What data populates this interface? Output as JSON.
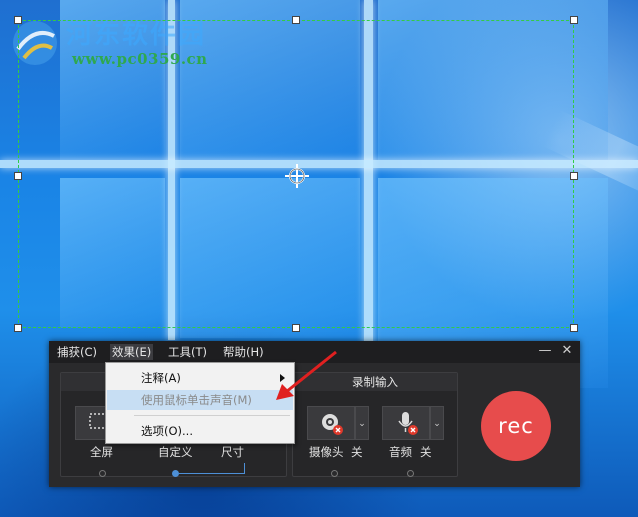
{
  "watermark": {
    "title": "河东软件园",
    "url": "www.pc0359.cn"
  },
  "recorder": {
    "menu": [
      {
        "label": "捕获(C)"
      },
      {
        "label": "效果(E)"
      },
      {
        "label": "工具(T)"
      },
      {
        "label": "帮助(H)"
      }
    ],
    "window_controls": {
      "minimize": "—",
      "close": "✕"
    },
    "capture_group": {
      "fullscreen_label": "全屏",
      "custom_label": "自定义",
      "size_label": "尺寸"
    },
    "record_input_group": {
      "title": "录制输入",
      "camera_label": "摄像头",
      "camera_state": "关",
      "audio_label": "音频",
      "audio_state": "关"
    },
    "rec_label": "rec"
  },
  "effects_menu": {
    "items": [
      {
        "label": "注释(A)",
        "has_submenu": true,
        "highlighted": false
      },
      {
        "label": "使用鼠标单击声音(M)",
        "has_submenu": false,
        "highlighted": true
      },
      {
        "label": "选项(O)...",
        "has_submenu": false,
        "highlighted": false
      }
    ]
  },
  "colors": {
    "selection_border": "#33cc44",
    "rec_button": "#e74c4c",
    "menu_highlight": "#c7def3",
    "pointer_arrow": "#e02020"
  },
  "icons": [
    "crosshair-move-icon",
    "fullscreen-icon",
    "webcam-icon",
    "microphone-icon",
    "disabled-badge-icon",
    "chevron-down-icon",
    "submenu-arrow-icon"
  ]
}
